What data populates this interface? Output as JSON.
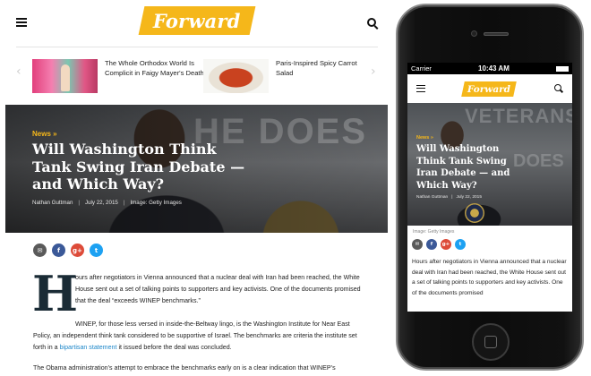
{
  "desktop": {
    "brand": "Forward",
    "related": [
      {
        "title": "The Whole Orthodox World Is Complicit in Faigy Mayer's Death"
      },
      {
        "title": "Paris-Inspired Spicy Carrot Salad"
      }
    ],
    "arrows": {
      "prev": "‹",
      "next": "›"
    },
    "hero": {
      "kicker": "News »",
      "title": "Will Washington Think Tank Swing Iran Debate — and Which Way?",
      "author": "Nathan Guttman",
      "date": "July 22, 2015",
      "image_credit": "Image: Getty Images"
    },
    "share": {
      "email": "✉",
      "facebook": "f",
      "google": "g+",
      "twitter": "t"
    },
    "article": {
      "dropcap": "H",
      "p1": "ours after negotiators in Vienna announced that a nuclear deal with Iran had been reached, the White House sent out a set of talking points to supporters and key activists. One of the documents promised that the deal “exceeds WINEP benchmarks.”",
      "p2_before": "WINEP, for those less versed in inside-the-Beltway lingo, is the Washington Institute for Near East Policy, an independent think tank considered to be supportive of Israel. The benchmarks are criteria the institute set forth in a ",
      "p2_link": "bipartisan statement",
      "p2_after": " it issued before the deal was concluded.",
      "p3": "The Obama administration’s attempt to embrace the benchmarks early on is a clear indication that WINEP’s"
    }
  },
  "phone": {
    "status": {
      "carrier": "Carrier",
      "time": "10:43 AM"
    },
    "brand": "Forward",
    "hero": {
      "kicker": "News »",
      "title": "Will Washington Think Tank Swing Iran Debate — and Which Way?",
      "author": "Nathan Guttman",
      "date": "July 22, 2015"
    },
    "caption": "Image: Getty Images",
    "paragraph": "Hours after negotiators in Vienna announced that a nuclear deal with Iran had been reached, the White House sent out a set of talking points to supporters and key activists. One of the documents promised"
  },
  "colors": {
    "accent": "#f5b71a",
    "link": "#1c86c9",
    "email": "#5a5a5a",
    "facebook": "#3b5998",
    "google": "#dd4b39",
    "twitter": "#1da1f2"
  }
}
